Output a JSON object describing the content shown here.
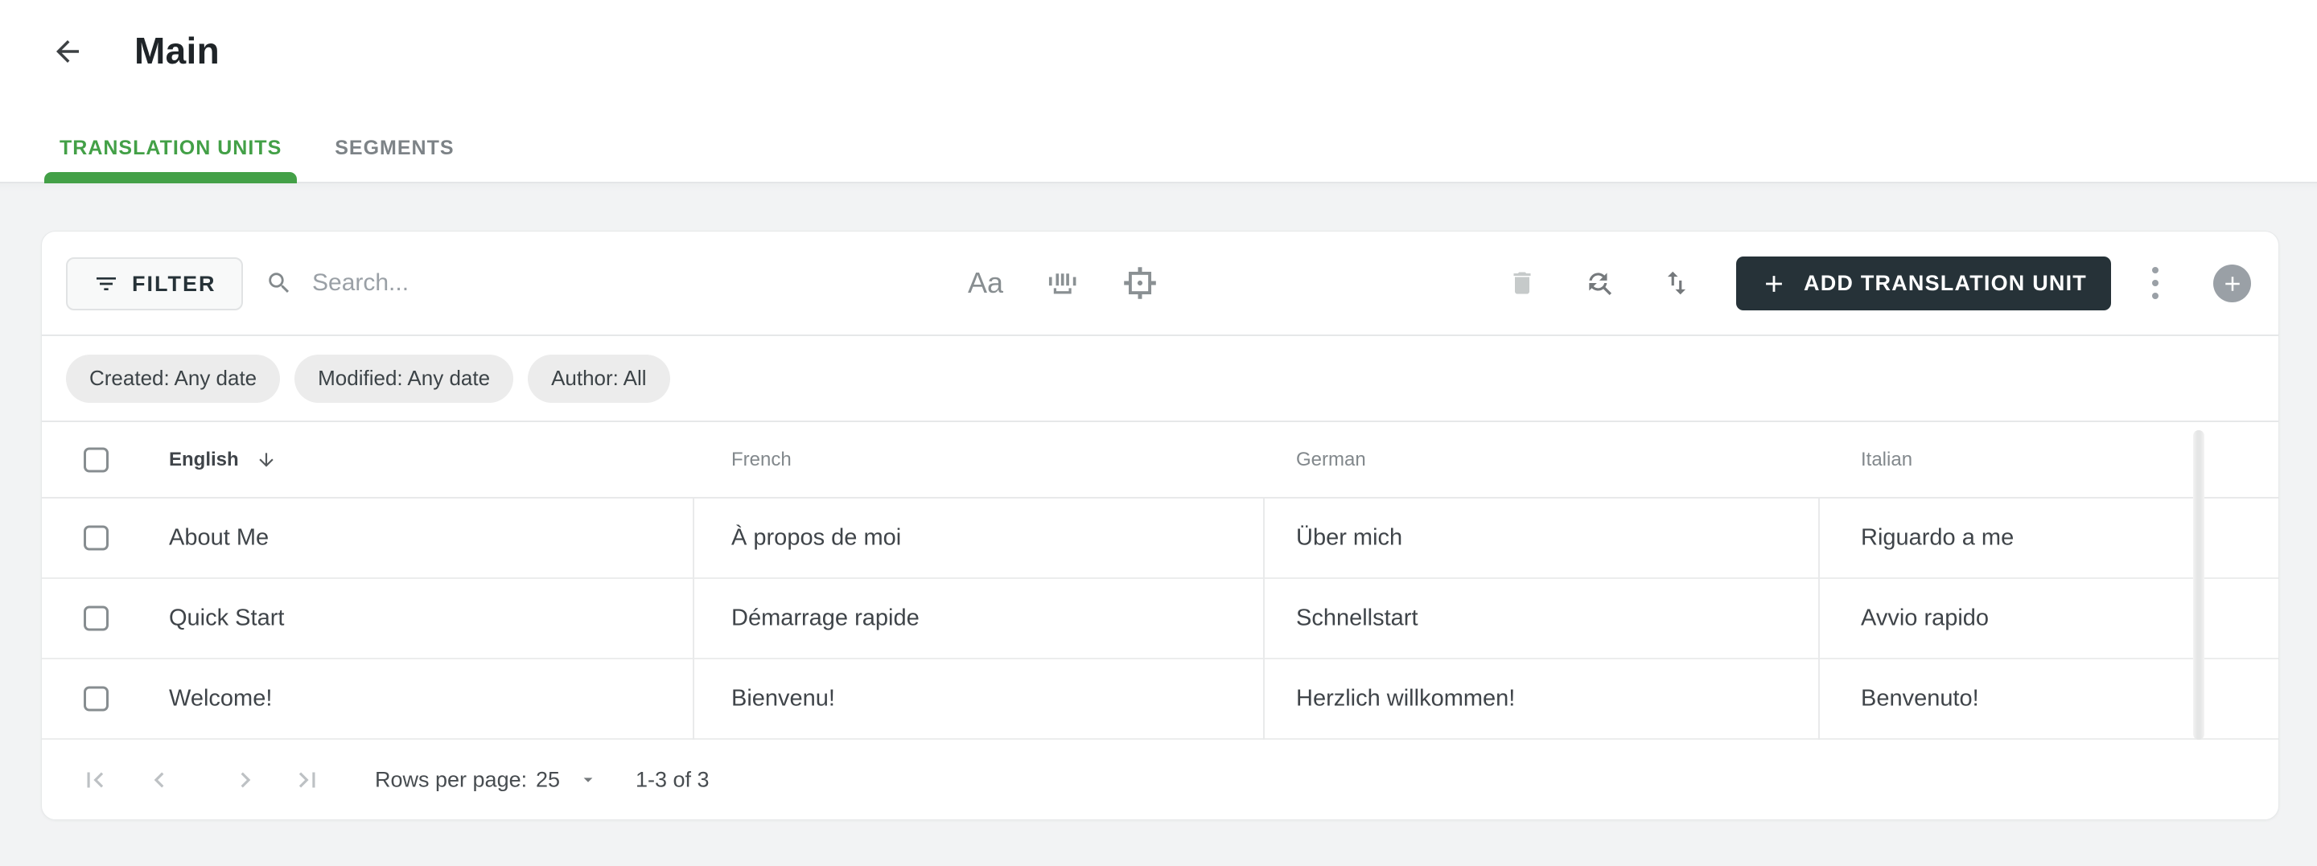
{
  "header": {
    "title": "Main"
  },
  "tabs": [
    {
      "label": "TRANSLATION UNITS",
      "active": true
    },
    {
      "label": "SEGMENTS",
      "active": false
    }
  ],
  "toolbar": {
    "filter_label": "FILTER",
    "search_placeholder": "Search...",
    "match_case_label": "Aa",
    "add_button_label": "ADD TRANSLATION UNIT"
  },
  "filter_chips": [
    {
      "label": "Created: Any date"
    },
    {
      "label": "Modified: Any date"
    },
    {
      "label": "Author: All"
    }
  ],
  "table": {
    "columns": [
      "English",
      "French",
      "German",
      "Italian"
    ],
    "sorted_column": "English",
    "sort_indicator": "arrow-down",
    "rows": [
      {
        "english": "About Me",
        "french": "À propos de moi",
        "german": "Über mich",
        "italian": "Riguardo a me"
      },
      {
        "english": "Quick Start",
        "french": "Démarrage rapide",
        "german": "Schnellstart",
        "italian": "Avvio rapido"
      },
      {
        "english": "Welcome!",
        "french": "Bienvenu!",
        "german": "Herzlich willkommen!",
        "italian": "Benvenuto!"
      }
    ]
  },
  "pagination": {
    "rows_per_page_label": "Rows per page:",
    "rows_per_page_value": "25",
    "range_label": "1-3 of 3"
  },
  "colors": {
    "accent_green": "#43a047",
    "dark_button_bg": "#263238",
    "chip_bg": "#ececec",
    "page_bg": "#f2f3f4"
  }
}
